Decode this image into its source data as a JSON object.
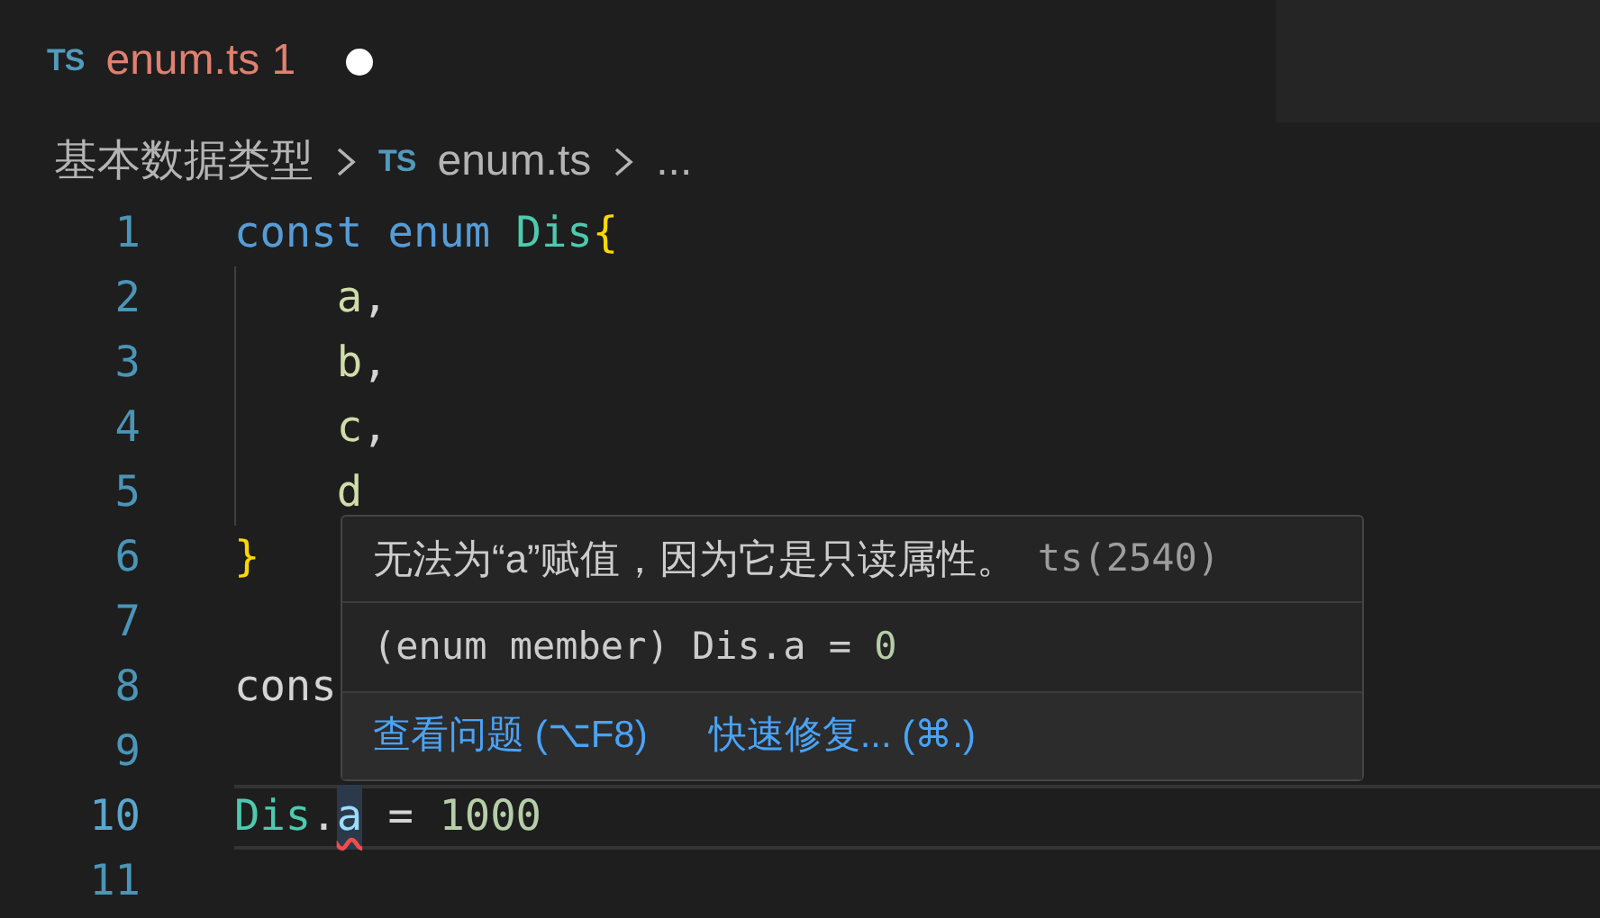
{
  "tab": {
    "icon": "TS",
    "label": "enum.ts",
    "problems": "1",
    "modified": true,
    "selected": true
  },
  "breadcrumb": [
    {
      "text": "基本数据类型"
    },
    {
      "icon": "TS",
      "text": "enum.ts"
    },
    {
      "text": "..."
    }
  ],
  "lines": [
    {
      "number": "1",
      "current": false,
      "tokens": [
        {
          "text": "const",
          "kind": "keyword"
        },
        {
          "text": "enum",
          "kind": "keyword"
        },
        {
          "text": "Dis",
          "kind": "type"
        },
        {
          "text": "{",
          "kind": "brace"
        }
      ]
    },
    {
      "number": "2",
      "current": false,
      "tokens": [
        {
          "text": "a",
          "kind": "member"
        },
        {
          "text": ",",
          "kind": "punct"
        }
      ]
    },
    {
      "number": "3",
      "current": false,
      "tokens": [
        {
          "text": "b",
          "kind": "member"
        },
        {
          "text": ",",
          "kind": "punct"
        }
      ]
    },
    {
      "number": "4",
      "current": false,
      "tokens": [
        {
          "text": "c",
          "kind": "member"
        },
        {
          "text": ",",
          "kind": "punct"
        }
      ]
    },
    {
      "number": "5",
      "current": false,
      "tokens": [
        {
          "text": "d",
          "kind": "member"
        }
      ]
    },
    {
      "number": "6",
      "current": false,
      "tokens": [
        {
          "text": "}",
          "kind": "brace"
        }
      ]
    },
    {
      "number": "7",
      "current": false
    },
    {
      "number": "8",
      "current": false,
      "tokens": [
        {
          "text": "cons",
          "kind": "plain"
        }
      ]
    },
    {
      "number": "9",
      "current": false
    },
    {
      "number": "10",
      "current": true,
      "tokens": [
        {
          "text": "Dis",
          "kind": "type"
        },
        {
          "text": ".",
          "kind": "punct"
        },
        {
          "text": "a",
          "kind": "error"
        },
        {
          "text": "=",
          "kind": "plain"
        },
        {
          "text": "1000",
          "kind": "number"
        }
      ]
    },
    {
      "number": "11",
      "current": false
    }
  ],
  "hover": {
    "message": "无法为“a”赋值，因为它是只读属性。",
    "code": "ts(2540)",
    "signature": [
      {
        "text": "(enum member) Dis.a = ",
        "kind": "plain"
      },
      {
        "text": "0",
        "kind": "number"
      }
    ],
    "actions": [
      "查看问题 (⌥F8)",
      "快速修复... (⌘.)"
    ]
  }
}
